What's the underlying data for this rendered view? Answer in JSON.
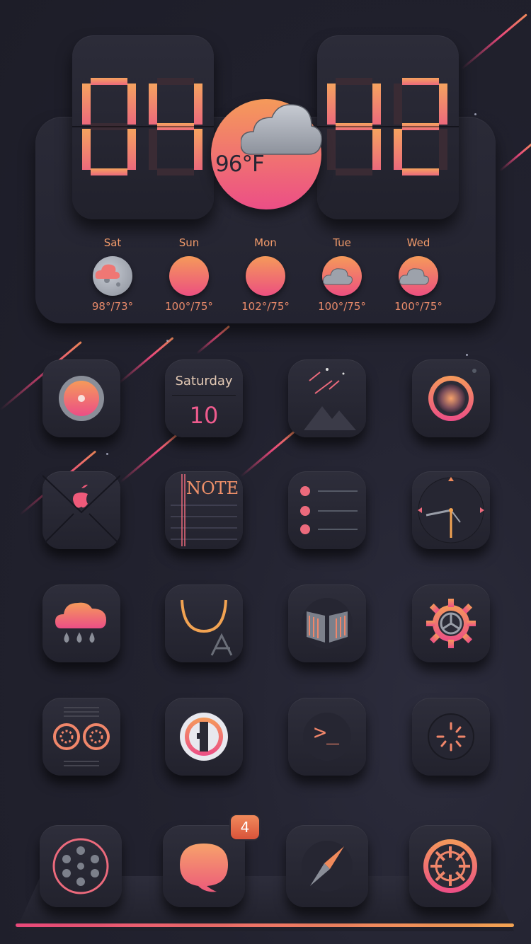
{
  "clock": {
    "hour": "04",
    "minute": "42"
  },
  "weather": {
    "current_temp": "96°F",
    "current_icon": "cloud-icon",
    "forecast": [
      {
        "day": "Sat",
        "temp": "98°/73°",
        "icon": "moon-cloud-icon"
      },
      {
        "day": "Sun",
        "temp": "100°/75°",
        "icon": "sun-icon"
      },
      {
        "day": "Mon",
        "temp": "102°/75°",
        "icon": "sun-icon"
      },
      {
        "day": "Tue",
        "temp": "100°/75°",
        "icon": "sun-cloud-icon"
      },
      {
        "day": "Wed",
        "temp": "100°/75°",
        "icon": "sun-cloud-icon"
      }
    ]
  },
  "calendar": {
    "weekday": "Saturday",
    "date": "10"
  },
  "notes": {
    "title": "NOTE"
  },
  "terminal": {
    "prompt": ">_"
  },
  "dock": {
    "messages_badge": "4"
  },
  "colors": {
    "accent_pink": "#ec4e86",
    "accent_orange": "#f59a5a",
    "background": "#1d1d28"
  }
}
